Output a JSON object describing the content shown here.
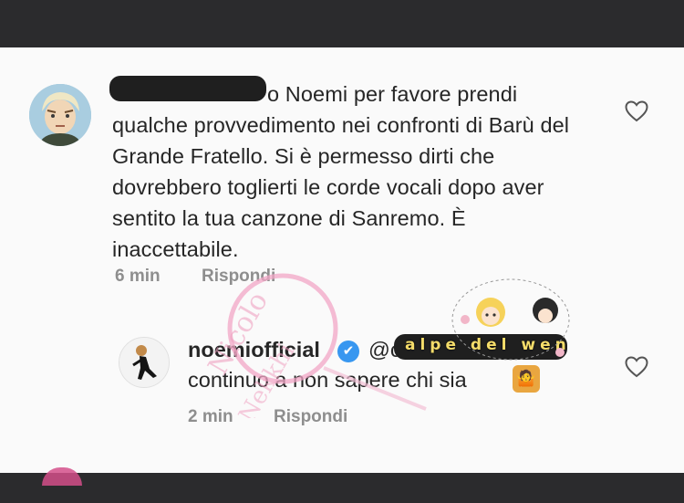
{
  "comment": {
    "text": "o Noemi per favore prendi qualche provvedimento nei confronti di Barù del Grande Fratello. Si è permesso dirti che dovrebbero toglierti le corde vocali dopo aver sentito la tua canzone di Sanremo. È inaccettabile.",
    "time": "6 min",
    "reply_label": "Rispondi"
  },
  "reply": {
    "username": "noemiofficial",
    "verified_mark": "✔",
    "mention": "@c",
    "text": "continuo a non sapere chi sia",
    "emoji": "🤷",
    "time": "2 min",
    "reply_label": "Rispondi"
  },
  "watermarks": {
    "signature": "Nicolo Nekkhi",
    "overlay_text": "alpe del wen"
  },
  "colors": {
    "text": "#262626",
    "meta": "#8e8e8e",
    "verified": "#3897f0",
    "background": "#fafafa",
    "frame": "#2b2b2d"
  }
}
